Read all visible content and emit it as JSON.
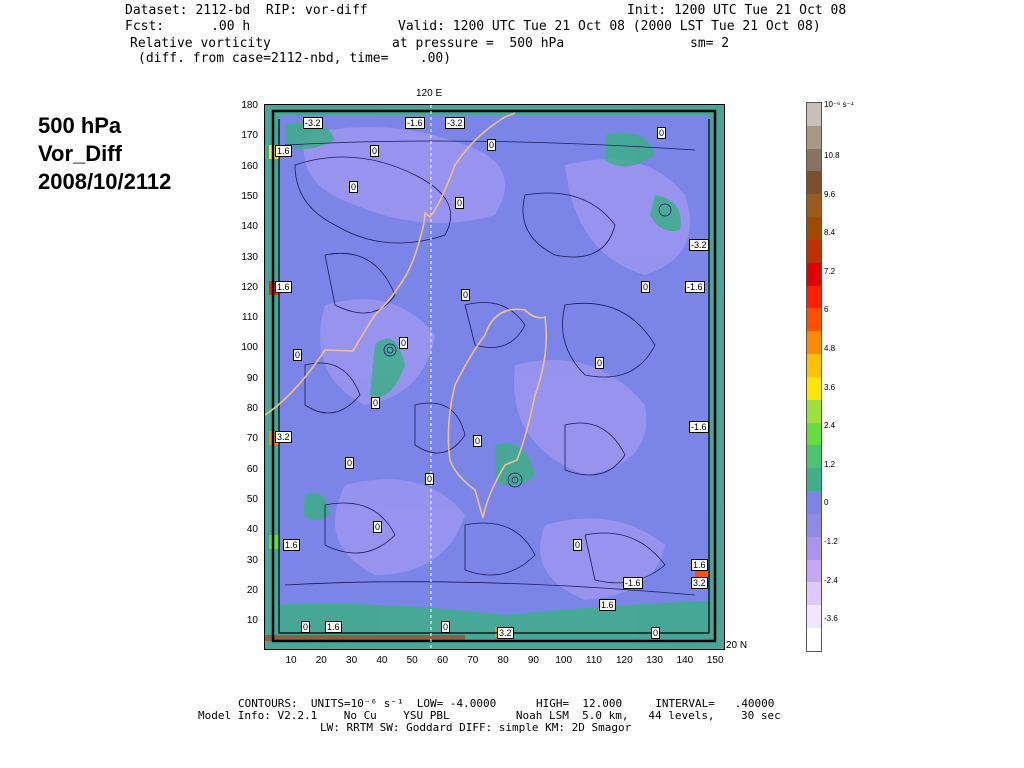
{
  "header": {
    "line1_left": "Dataset: 2112-bd  RIP: vor-diff",
    "line1_right": "Init: 1200 UTC Tue 21 Oct 08",
    "line2_left": "Fcst:      .00 h",
    "line2_right": "Valid: 1200 UTC Tue 21 Oct 08 (2000 LST Tue 21 Oct 08)",
    "line3_left": "Relative vorticity",
    "line3_mid": "at pressure =  500 hPa",
    "line3_right": "sm= 2",
    "line4": "(diff. from case=2112-nbd, time=    .00)"
  },
  "side_title": [
    "500 hPa",
    "Vor_Diff",
    "2008/10/2112"
  ],
  "map": {
    "top_label": "120 E",
    "corner_label": "20 N",
    "y_ticks": [
      "180",
      "170",
      "160",
      "150",
      "140",
      "130",
      "120",
      "110",
      "100",
      "90",
      "80",
      "70",
      "60",
      "50",
      "40",
      "30",
      "20",
      "10"
    ],
    "x_ticks": [
      "10",
      "20",
      "30",
      "40",
      "50",
      "60",
      "70",
      "80",
      "90",
      "100",
      "110",
      "120",
      "130",
      "140",
      "150"
    ],
    "contour_labels": [
      "-3.2",
      "-1.6",
      "-3.2",
      "1.6",
      "0",
      "0",
      "0",
      "0",
      "0",
      "-3.2",
      "1.6",
      "0",
      "0",
      "-1.6",
      "0",
      "0",
      "0",
      "0",
      "3.2",
      "0",
      "-1.6",
      "0",
      "0",
      "1.6",
      "0",
      "1.6",
      "0",
      "3.2",
      "-1.6",
      "1.6",
      "0",
      "1.6",
      "0",
      "3.2",
      "0"
    ]
  },
  "colorbar": {
    "unit": "10⁻⁶ s⁻¹",
    "labels": [
      "10.8",
      "9.6",
      "8.4",
      "7.2",
      "6",
      "4.8",
      "3.6",
      "2.4",
      "1.2",
      "0",
      "-1.2",
      "-2.4",
      "-3.6"
    ],
    "colors": [
      "#ffffff",
      "#f0e6ff",
      "#ddc8ff",
      "#c4a8f5",
      "#a994ee",
      "#8f8ae6",
      "#7b85e8",
      "#3fae8a",
      "#4cc272",
      "#66dc40",
      "#9ee03a",
      "#ffe600",
      "#ffc000",
      "#ff8a00",
      "#ff5000",
      "#ff2000",
      "#e00000",
      "#c03000",
      "#a04a00",
      "#9a5a1a",
      "#7a5030",
      "#8a7260",
      "#a89888",
      "#c8c0b8"
    ]
  },
  "footer": {
    "line1": "CONTOURS:  UNITS=10⁻⁶ s⁻¹  LOW= -4.0000      HIGH=  12.000     INTERVAL=   .40000",
    "line2": "Model Info: V2.2.1    No Cu    YSU PBL          Noah LSM  5.0 km,   44 levels,    30 sec",
    "line3": "LW: RRTM SW: Goddard DIFF: simple KM: 2D Smagor"
  }
}
